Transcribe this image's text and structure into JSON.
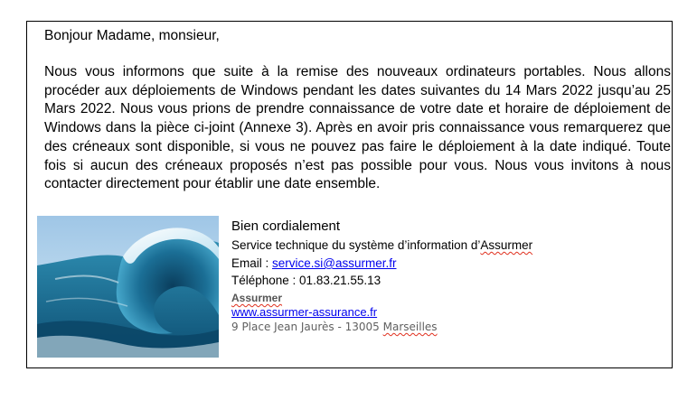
{
  "message": {
    "greeting": "Bonjour Madame, monsieur,",
    "body": "Nous vous informons que suite à la remise des nouveaux ordinateurs portables. Nous allons procéder aux déploiements de Windows pendant les dates suivantes du 14 Mars 2022 jusqu’au 25 Mars 2022. Nous vous prions de prendre connaissance de votre date et horaire de déploiement de Windows dans la pièce ci-joint (Annexe 3). Après en avoir pris connaissance vous remarquerez que des créneaux sont disponible, si vous ne pouvez pas faire le déploiement à la date indiqué. Toute fois si aucun des créneaux proposés n’est pas possible pour vous. Nous vous invitons à nous contacter directement pour établir une date ensemble."
  },
  "signature": {
    "regards": "Bien cordialement",
    "service_prefix": "Service technique du système d’information d’",
    "service_company": "Assurmer",
    "email_label": "Email : ",
    "email": "service.si@assurmer.fr",
    "phone": "Téléphone : 01.83.21.55.13",
    "company": "Assurmer",
    "website": "www.assurmer-assurance.fr",
    "address_prefix": "9 Place Jean Jaurès - 13005 ",
    "address_city": "Marseilles"
  },
  "image": {
    "icon": "ocean-wave-image"
  },
  "colors": {
    "link": "#0000ee",
    "spellcheck": "#e0301e",
    "frame_border": "#000000"
  }
}
